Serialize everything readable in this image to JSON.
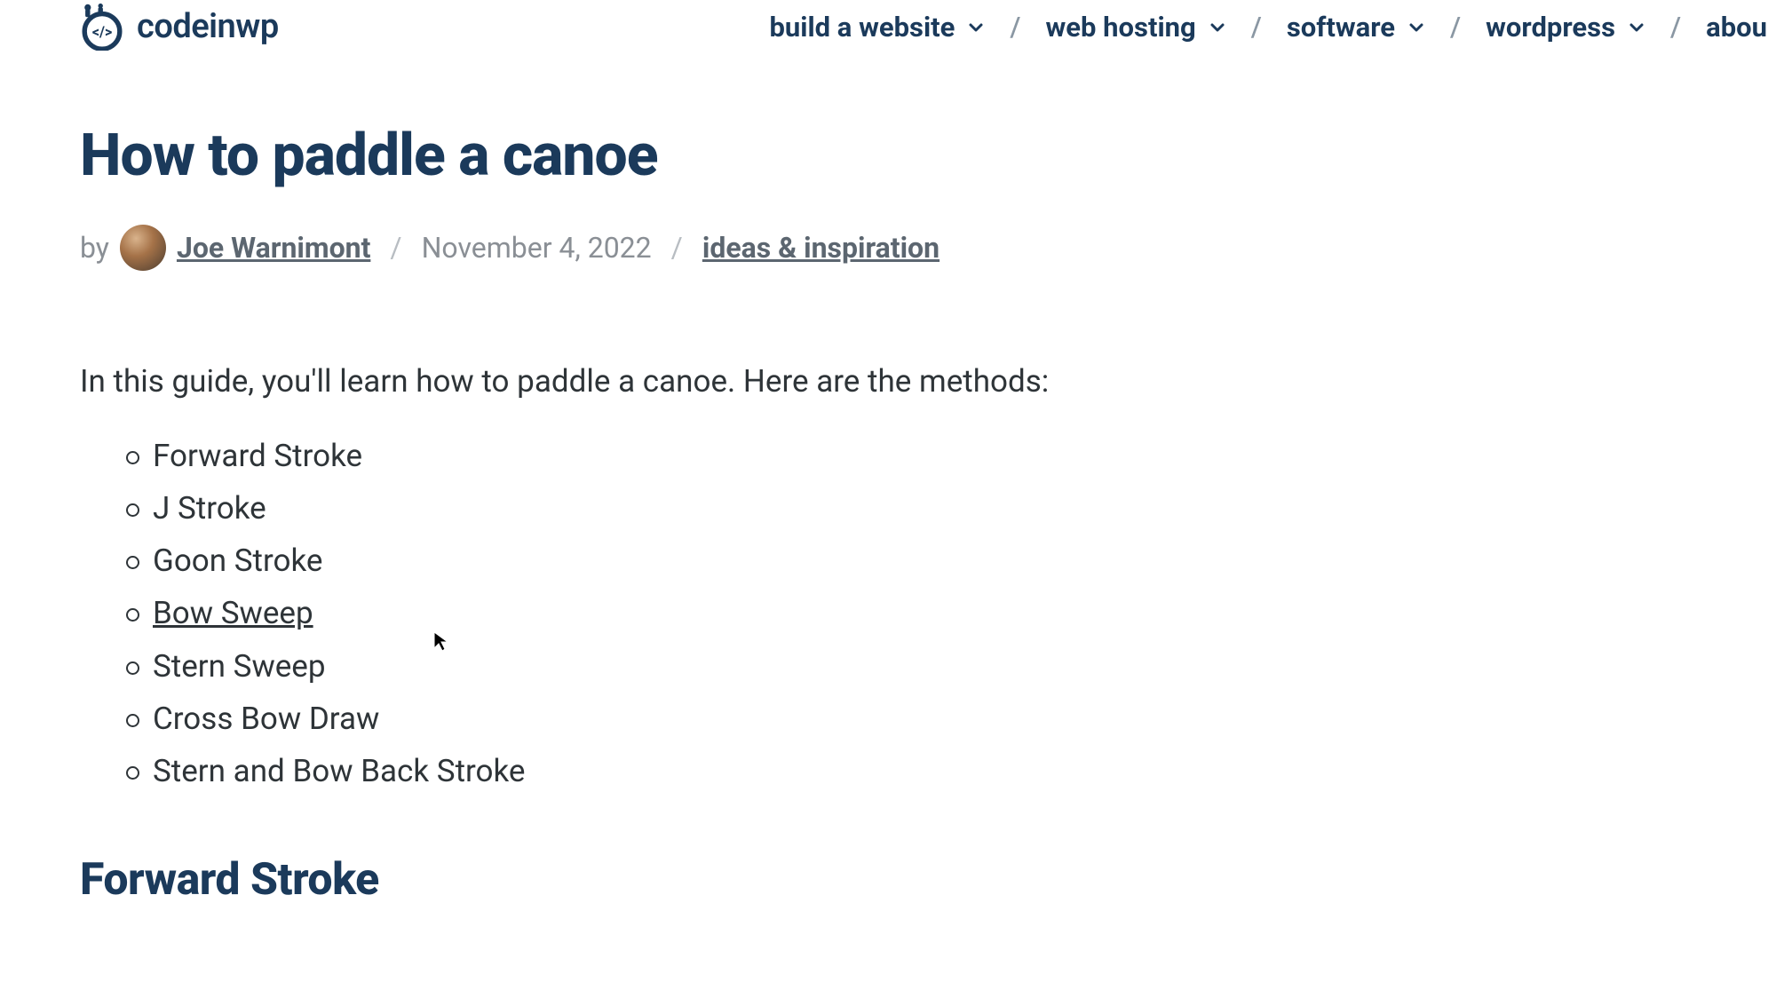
{
  "brand": {
    "name": "codeinwp"
  },
  "nav": {
    "items": [
      {
        "label": "build a website"
      },
      {
        "label": "web hosting"
      },
      {
        "label": "software"
      },
      {
        "label": "wordpress"
      },
      {
        "label": "abou"
      }
    ],
    "sep": "/"
  },
  "article": {
    "title": "How to paddle a canoe",
    "by": "by",
    "author": "Joe Warnimont",
    "date": "November 4, 2022",
    "category": "ideas & inspiration",
    "intro": "In this guide, you'll learn how to paddle a canoe. Here are the methods:",
    "methods": [
      "Forward Stroke",
      "J Stroke",
      "Goon Stroke",
      "Bow Sweep",
      "Stern Sweep",
      "Cross Bow Draw",
      "Stern and Bow Back Stroke"
    ],
    "section_heading": "Forward Stroke"
  }
}
